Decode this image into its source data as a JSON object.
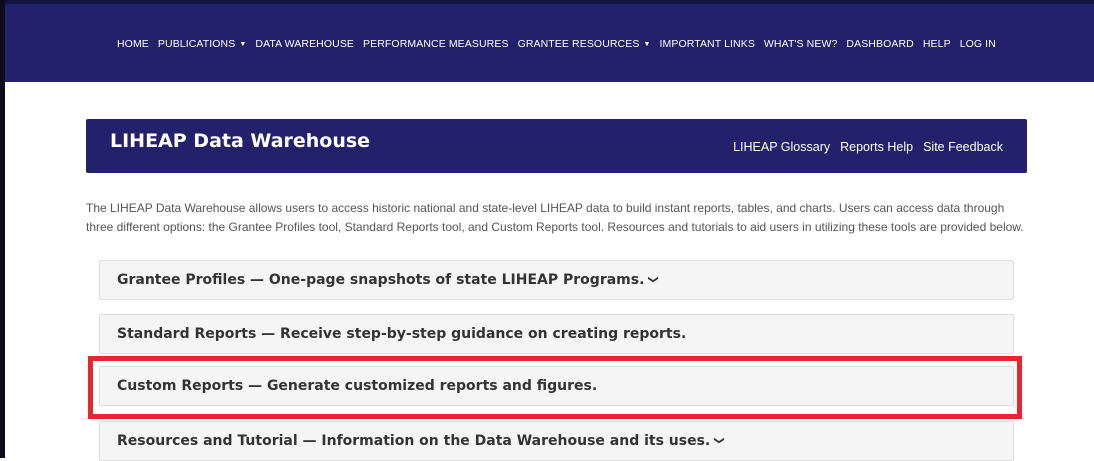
{
  "nav": {
    "items": [
      {
        "label": "HOME",
        "dropdown": false
      },
      {
        "label": "PUBLICATIONS",
        "dropdown": true
      },
      {
        "label": "DATA WAREHOUSE",
        "dropdown": false
      },
      {
        "label": "PERFORMANCE MEASURES",
        "dropdown": false
      },
      {
        "label": "GRANTEE RESOURCES",
        "dropdown": true
      },
      {
        "label": "IMPORTANT LINKS",
        "dropdown": false
      },
      {
        "label": "WHAT'S NEW?",
        "dropdown": false
      },
      {
        "label": "DASHBOARD",
        "dropdown": false
      },
      {
        "label": "HELP",
        "dropdown": false
      },
      {
        "label": "LOG IN",
        "dropdown": false
      }
    ]
  },
  "header": {
    "title": "LIHEAP Data Warehouse",
    "links": [
      "LIHEAP Glossary",
      "Reports Help",
      "Site Feedback"
    ]
  },
  "intro": "The LIHEAP Data Warehouse allows users to access historic national and state-level LIHEAP data to build instant reports, tables, and charts. Users can access data through three different options: the Grantee Profiles tool, Standard Reports tool, and Custom Reports tool. Resources and tutorials to aid users in utilizing these tools are provided below.",
  "panels": [
    {
      "title": "Grantee Profiles — One-page snapshots of state LIHEAP Programs.",
      "chevron": true
    },
    {
      "title": "Standard Reports — Receive step-by-step guidance on creating reports.",
      "chevron": false
    },
    {
      "title": "Custom Reports — Generate customized reports and figures.",
      "chevron": false,
      "highlighted": true
    },
    {
      "title": "Resources and Tutorial — Information on the Data Warehouse and its uses.",
      "chevron": true
    }
  ],
  "colors": {
    "navy": "#23216b",
    "highlight": "#e8262e",
    "panel_bg": "#f5f5f5"
  },
  "icons": {
    "dropdown": "chevron-down-icon"
  }
}
